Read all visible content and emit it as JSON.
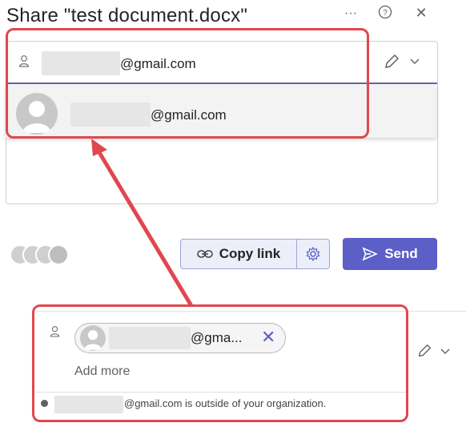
{
  "dialog": {
    "title": "Share \"test document.docx\"",
    "more_icon": "more-horizontal-icon",
    "help_icon": "help-icon",
    "close_icon": "close-icon"
  },
  "picker": {
    "email_suffix": "@gmail.com",
    "permission_icon": "pencil-icon",
    "chevron_icon": "chevron-down-icon"
  },
  "suggestion": {
    "email_suffix": "@gmail.com"
  },
  "actions": {
    "copy_link_label": "Copy link",
    "send_label": "Send"
  },
  "zoomed": {
    "chip_email_suffix": "@gma...",
    "add_more_placeholder": "Add more",
    "external_warning": "@gmail.com is outside of your organization."
  },
  "colors": {
    "accent": "#5b5fc7",
    "annotation_red": "#e0474f"
  }
}
